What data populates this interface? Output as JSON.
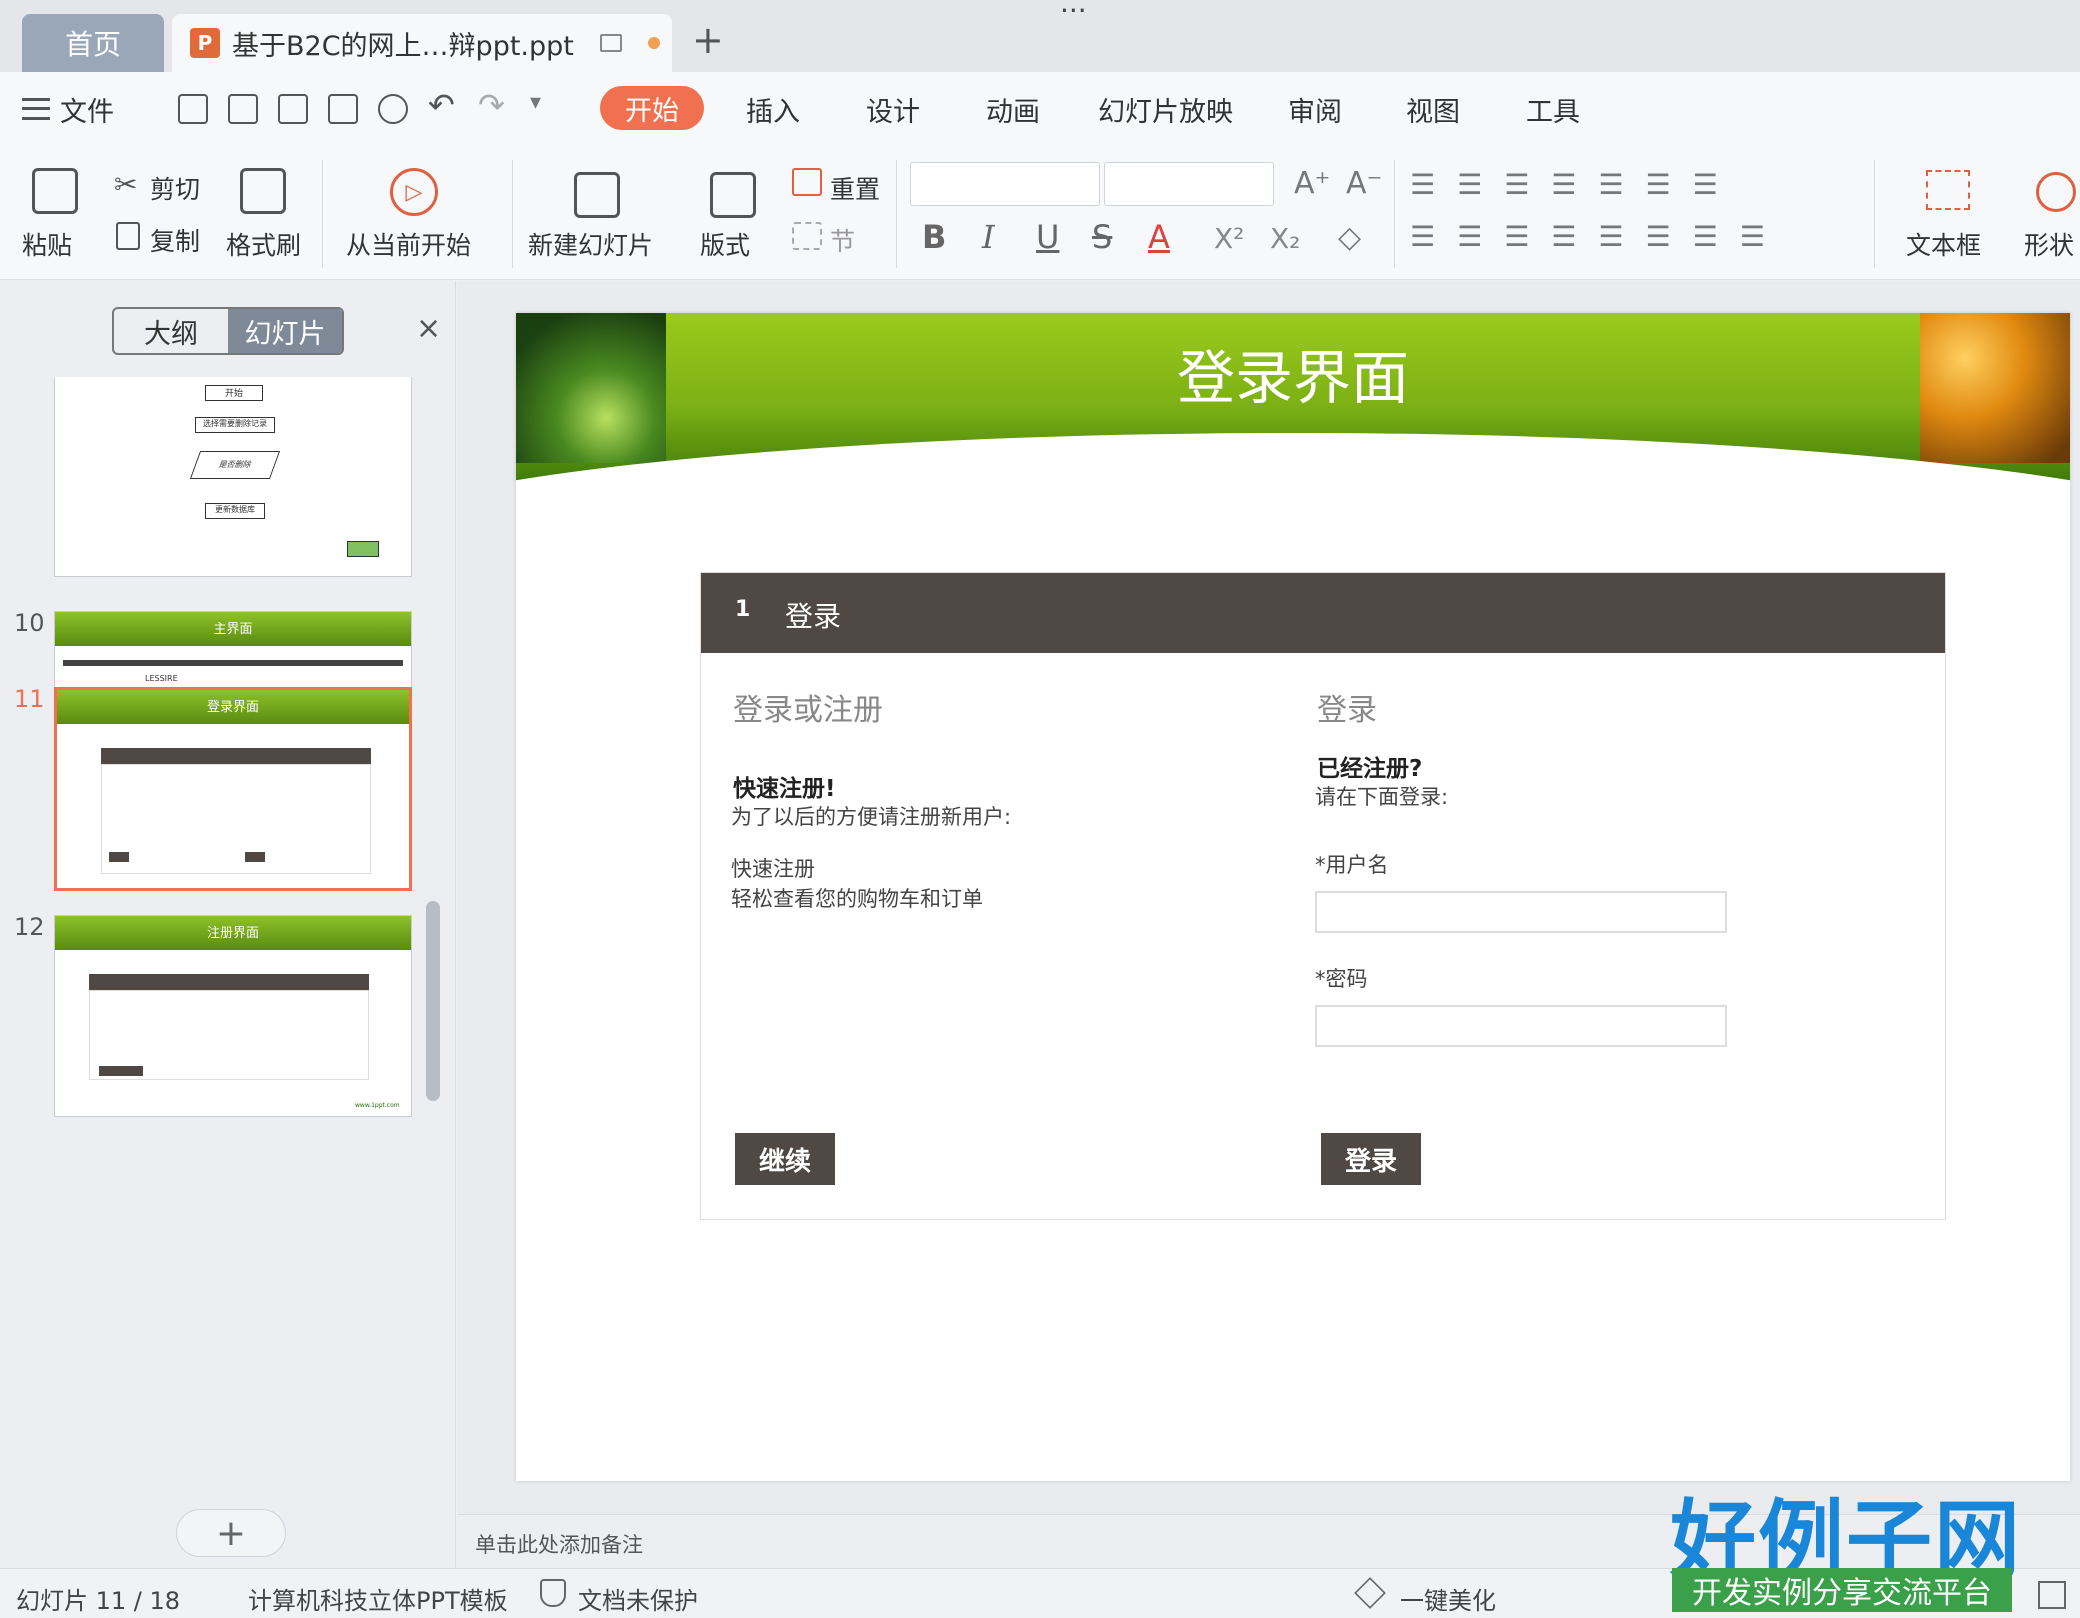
{
  "window": {
    "title": "..."
  },
  "tabs": {
    "home": "首页",
    "document": "基于B2C的网上…辩ppt.ppt",
    "add": "+"
  },
  "menu": {
    "file": "文件",
    "items": [
      "开始",
      "插入",
      "设计",
      "动画",
      "幻灯片放映",
      "审阅",
      "视图",
      "工具"
    ]
  },
  "ribbon": {
    "paste": "粘贴",
    "cut": "剪切",
    "copy": "复制",
    "format_painter": "格式刷",
    "from_current": "从当前开始",
    "new_slide": "新建幻灯片",
    "layout": "版式",
    "reset": "重置",
    "section": "节",
    "bold": "B",
    "italic": "I",
    "underline": "U",
    "strike": "S",
    "font_color": "A",
    "text_box": "文本框",
    "shape": "形状"
  },
  "left_panel": {
    "outline": "大纲",
    "slides": "幻灯片",
    "close": "×",
    "add": "+",
    "thumb9": {
      "flow_start": "开始",
      "flow_select": "选择需要删除记录",
      "flow_decide": "是否删除",
      "flow_update": "更新数据库"
    },
    "thumb10": {
      "number": "10",
      "title": "主界面",
      "brand": "LESSIRE"
    },
    "thumb11": {
      "number": "11",
      "title": "登录界面"
    },
    "thumb12": {
      "number": "12",
      "title": "注册界面",
      "footer": "www.1ppt.com"
    }
  },
  "slide": {
    "title": "登录界面",
    "header_num": "1",
    "header_label": "登录",
    "left_heading": "登录或注册",
    "quick_title": "快速注册!",
    "quick_desc": "为了以后的方便请注册新用户:",
    "quick_line1": "快速注册",
    "quick_line2": "轻松查看您的购物车和订单",
    "continue_btn": "继续",
    "right_heading": "登录",
    "registered_title": "已经注册?",
    "registered_desc": "请在下面登录:",
    "username_label": "*用户名",
    "password_label": "*密码",
    "login_btn": "登录"
  },
  "notes": {
    "placeholder": "单击此处添加备注"
  },
  "status": {
    "slide_counter": "幻灯片 11 / 18",
    "template": "计算机科技立体PPT模板",
    "protection": "文档未保护",
    "beautify": "一键美化"
  },
  "watermark": {
    "logo": "好例子网",
    "sub": "开发实例分享交流平台"
  },
  "colors": {
    "accent": "#f07050",
    "slide_green": "#7cb014",
    "dark_header": "#4f4844"
  }
}
